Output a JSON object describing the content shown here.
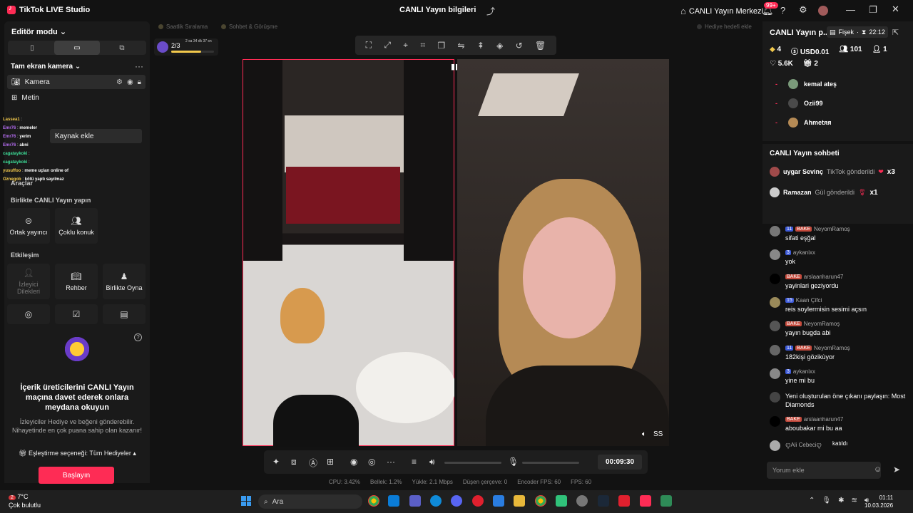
{
  "titlebar": {
    "app_name": "TikTok LIVE Studio",
    "center_title": "CANLI Yayın bilgileri",
    "live_center": "CANLI Yayın Merkezi",
    "notif_badge": "99+"
  },
  "left": {
    "editor_mode": "Editör modu",
    "scene_title": "Tam ekran kamera",
    "sources": [
      {
        "label": "Kamera"
      },
      {
        "label": "Metin"
      }
    ],
    "overlay_chat": [
      {
        "name": "Lassea1",
        "text": "",
        "color": "#f2c94c"
      },
      {
        "name": "Emr76",
        "text": "memeler",
        "color": "#b46cf0"
      },
      {
        "name": "Emr76",
        "text": "yerim",
        "color": "#b46cf0"
      },
      {
        "name": "Emr76",
        "text": "abni",
        "color": "#b46cf0"
      },
      {
        "name": "cagataykoki",
        "text": "",
        "color": "#3ddc97"
      },
      {
        "name": "cagataykoki",
        "text": "",
        "color": "#3ddc97"
      },
      {
        "name": "yusuffoo",
        "text": "meme uçları online of",
        "color": "#f2c94c"
      },
      {
        "name": "Oznegob",
        "text": "kötü yaptı sayılmaz",
        "color": "#f2c94c"
      }
    ],
    "add_source": "Kaynak ekle",
    "tools_title": "Araçlar",
    "collab_title": "Birlikte CANLI Yayın yapın",
    "collab_buttons": [
      {
        "label": "Ortak yayıncı"
      },
      {
        "label": "Çoklu konuk"
      }
    ],
    "interaction_title": "Etkileşim",
    "interaction_buttons": [
      {
        "label": "İzleyici Dilekleri"
      },
      {
        "label": "Rehber"
      },
      {
        "label": "Birlikte Oyna"
      }
    ],
    "promo": {
      "title": "İçerik üreticilerini CANLI Yayın maçına davet ederek onlara meydana okuyun",
      "desc": "İzleyiciler Hediye ve beğeni gönderebilir. Nihayetinde en çok puana sahip olan kazanır!",
      "option": "Eşleştirme seçeneği: Tüm Hediyeler",
      "button": "Başlayın"
    }
  },
  "top": {
    "chip1": "Saatlik Sıralama",
    "chip2": "Sohbet & Görüşme",
    "chip3": "Hediye hedefi ekle",
    "level_count": "2/3",
    "level_time": "2 sa 34 dk 37 sn",
    "level_progress": 0.7
  },
  "video": {
    "ss_label": "SS"
  },
  "controls": {
    "timer": "00:09:30"
  },
  "stats": [
    {
      "label": "CPU:",
      "value": "3.42%"
    },
    {
      "label": "Bellek:",
      "value": "1.2%"
    },
    {
      "label": "Yükle:",
      "value": "2.1 Mbps"
    },
    {
      "label": "Düşen çerçeve:",
      "value": "0"
    },
    {
      "label": "Encoder FPS:",
      "value": "60"
    },
    {
      "label": "FPS:",
      "value": "60"
    }
  ],
  "right": {
    "title": "CANLI Yayın p...",
    "pill_label": "Fişek",
    "pill_time": "22:12",
    "stats1": [
      {
        "icon": "diamond",
        "value": "4"
      },
      {
        "icon": "coin",
        "value": "USD0.01"
      },
      {
        "icon": "people",
        "value": "101"
      },
      {
        "icon": "follow",
        "value": "1"
      }
    ],
    "stats2": [
      {
        "icon": "heart",
        "value": "5.6K"
      },
      {
        "icon": "gift",
        "value": "2"
      }
    ],
    "viewers": [
      {
        "name": "kemal ateş"
      },
      {
        "name": "Ozii99"
      },
      {
        "name": "Ahmetяя"
      }
    ],
    "chat_title": "CANLI Yayın sohbeti",
    "gifts": [
      {
        "name": "uygar Sevinç",
        "text": "TikTok gönderildi",
        "mult": "x3"
      },
      {
        "name": "Ramazan",
        "text": "Gül gönderildi",
        "mult": "x1"
      }
    ],
    "messages": [
      {
        "level": "11",
        "fan": "BAKE",
        "name": "NeyomRamoş",
        "text": "sifati eşğal"
      },
      {
        "level": "3",
        "fan": "",
        "name": "aykanixx",
        "text": "yok"
      },
      {
        "level": "",
        "fan": "BAKE",
        "name": "arslaanharun47",
        "text": "yayinlari geziyordu"
      },
      {
        "level": "15",
        "fan": "",
        "name": "Kaan Çifci",
        "text": "reis soylermisin sesimi açsın"
      },
      {
        "level": "",
        "fan": "BAKE",
        "name": "NeyomRamoş",
        "text": "yayın bugda abi"
      },
      {
        "level": "11",
        "fan": "BAKE",
        "name": "NeyomRamoş",
        "text": "182kişi gözikùyor"
      },
      {
        "level": "3",
        "fan": "",
        "name": "aykanixx",
        "text": "yine mi bu"
      },
      {
        "level": "",
        "fan": "",
        "name": "",
        "text": "Yeni oluşturulan öne çıkanı paylaşın: Most Diamonds"
      },
      {
        "level": "",
        "fan": "BAKE",
        "name": "arslaanharun47",
        "text": "aboubakar mi bu aa"
      },
      {
        "level": "",
        "fan": "",
        "name": "ꨄAli Cebeciꨄ",
        "text": "katıldı"
      }
    ],
    "comment_placeholder": "Yorum ekle"
  },
  "taskbar": {
    "temp": "7°C",
    "weather": "Çok bulutlu",
    "weather_badge": "2",
    "search": "Ara",
    "time": "01:11",
    "date": "10.03.2026"
  },
  "colors": {
    "accent": "#fe2c55",
    "panel": "#1a1a1a",
    "bg": "#121212"
  }
}
